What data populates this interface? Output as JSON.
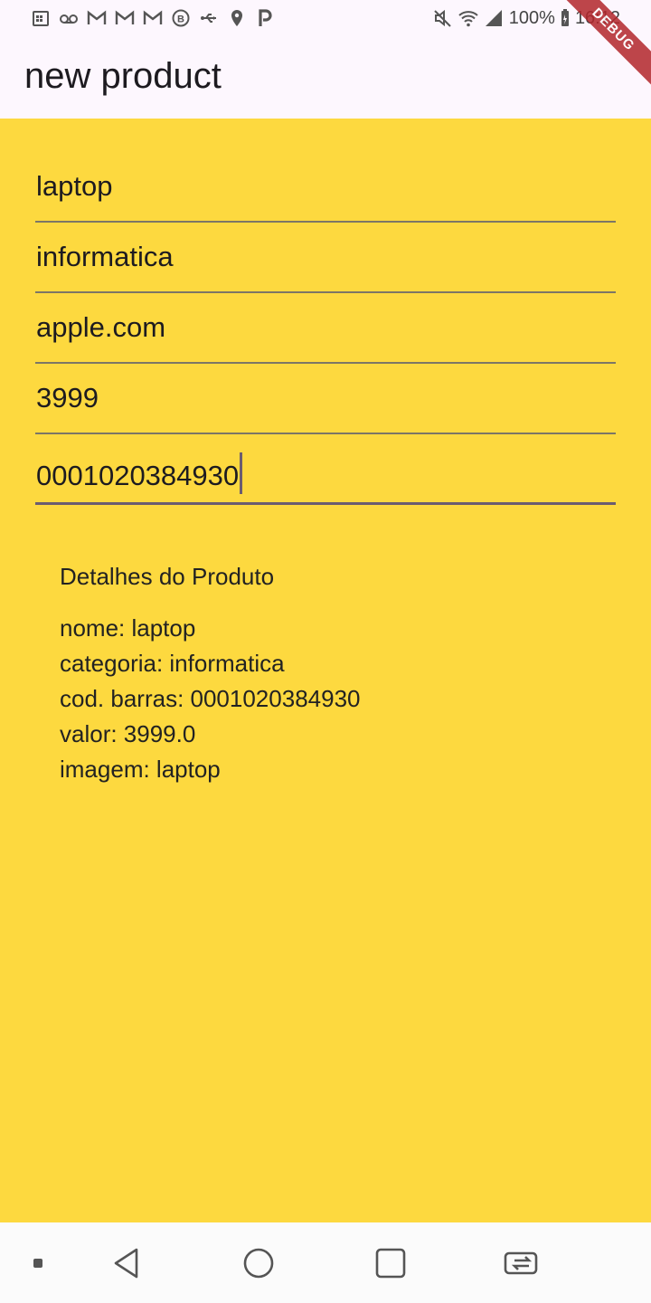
{
  "status_bar": {
    "battery": "100%",
    "time": "16:12"
  },
  "app_bar": {
    "title": "new product",
    "debug_banner": "DEBUG"
  },
  "form": {
    "fields": [
      {
        "value": "laptop"
      },
      {
        "value": "informatica"
      },
      {
        "value": "apple.com"
      },
      {
        "value": "3999"
      },
      {
        "value": "0001020384930"
      }
    ]
  },
  "details": {
    "title": "Detalhes do Produto",
    "lines": [
      "nome: laptop",
      "categoria: informatica",
      "cod. barras: 0001020384930",
      "valor: 3999.0",
      "imagem: laptop"
    ]
  },
  "nav": {
    "buttons": [
      "back-icon",
      "home-icon",
      "recents-icon",
      "switch-apps-icon"
    ]
  }
}
